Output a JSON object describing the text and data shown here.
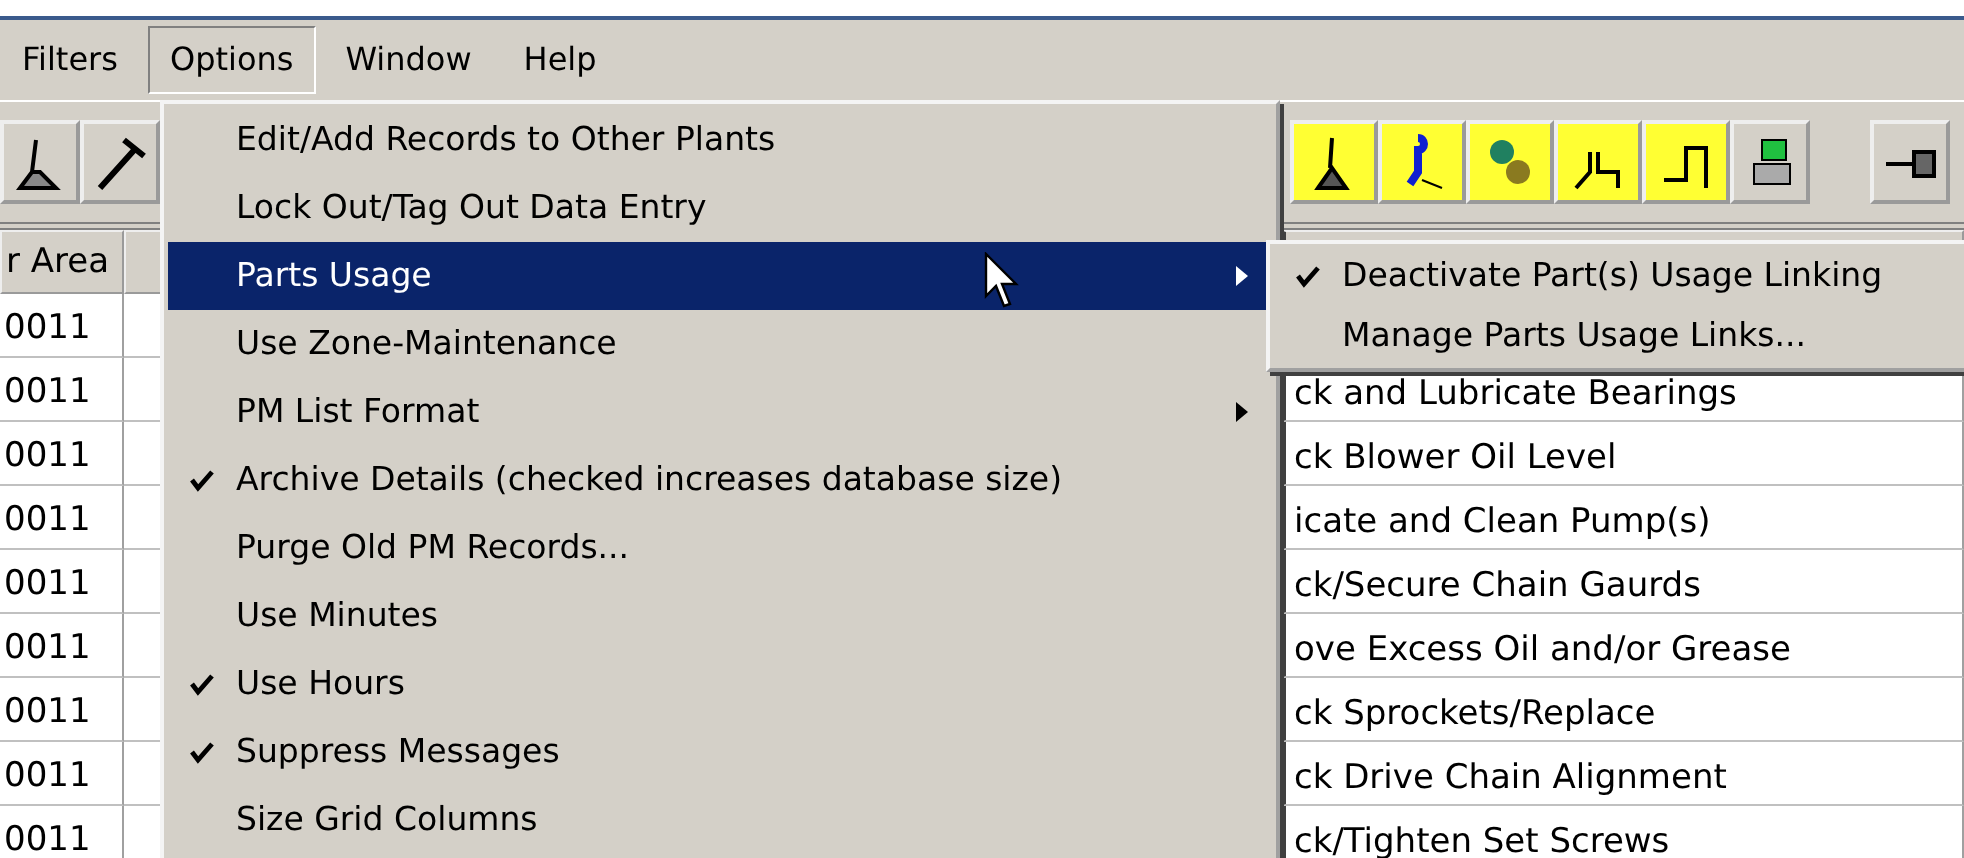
{
  "menubar": [
    {
      "label": "Filters",
      "selected": false
    },
    {
      "label": "Options",
      "selected": true
    },
    {
      "label": "Window",
      "selected": false
    },
    {
      "label": "Help",
      "selected": false
    }
  ],
  "grid": {
    "columns": [
      "r Area"
    ],
    "rows": [
      {
        "area": "0011"
      },
      {
        "area": "0011",
        "description": "ck and Lubricate Bearings"
      },
      {
        "area": "0011",
        "description": "ck Blower Oil Level"
      },
      {
        "area": "0011",
        "description": "icate and Clean Pump(s)"
      },
      {
        "area": "0011",
        "description": "ck/Secure Chain Gaurds"
      },
      {
        "area": "0011",
        "description": "ove Excess Oil and/or Grease"
      },
      {
        "area": "0011",
        "description": "ck Sprockets/Replace"
      },
      {
        "area": "0011",
        "description": "ck Drive Chain Alignment"
      },
      {
        "area": "0011",
        "description": "ck/Tighten Set Screws"
      }
    ]
  },
  "options_menu": {
    "items": [
      {
        "label": "Edit/Add Records to Other Plants",
        "checked": false,
        "selected": false,
        "submenu": false
      },
      {
        "label": "Lock Out/Tag Out Data Entry",
        "checked": false,
        "selected": false,
        "submenu": false
      },
      {
        "label": "Parts Usage",
        "checked": false,
        "selected": true,
        "submenu": true
      },
      {
        "label": "Use Zone-Maintenance",
        "checked": false,
        "selected": false,
        "submenu": false
      },
      {
        "label": "PM List Format",
        "checked": false,
        "selected": false,
        "submenu": true
      },
      {
        "label": "Archive Details (checked increases database size)",
        "checked": true,
        "selected": false,
        "submenu": false
      },
      {
        "label": "Purge Old PM Records...",
        "checked": false,
        "selected": false,
        "submenu": false
      },
      {
        "label": "Use Minutes",
        "checked": false,
        "selected": false,
        "submenu": false
      },
      {
        "label": "Use Hours",
        "checked": true,
        "selected": false,
        "submenu": false
      },
      {
        "label": "Suppress Messages",
        "checked": true,
        "selected": false,
        "submenu": false
      },
      {
        "label": "Size Grid Columns",
        "checked": false,
        "selected": false,
        "submenu": false
      }
    ]
  },
  "parts_usage_submenu": {
    "items": [
      {
        "label": "Deactivate Part(s) Usage Linking",
        "checked": true
      },
      {
        "label": "Manage Parts Usage Links...",
        "checked": false
      }
    ]
  }
}
